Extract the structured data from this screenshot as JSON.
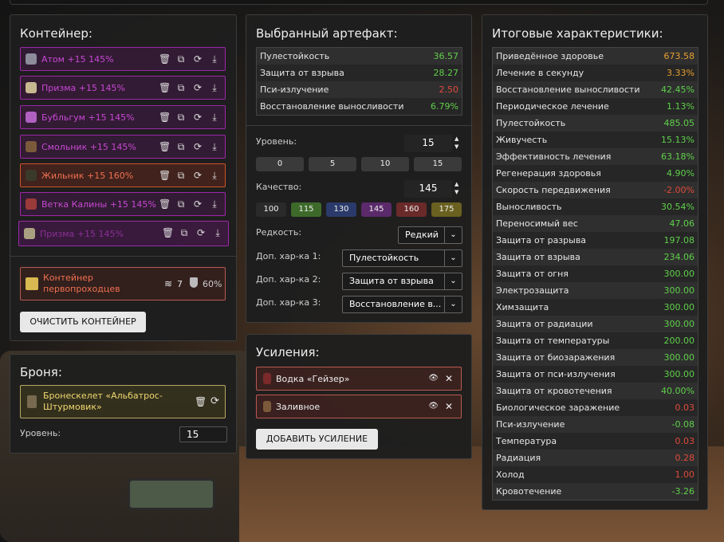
{
  "container": {
    "title": "Контейнер:",
    "items": [
      {
        "name": "Атом +15 145%",
        "color": "#8c8c9a"
      },
      {
        "name": "Призма +15 145%",
        "color": "#c8b890"
      },
      {
        "name": "Бубльгум +15 145%",
        "color": "#b060c0"
      },
      {
        "name": "Смольник +15 145%",
        "color": "#7a5a3a"
      },
      {
        "name": "Жильник +15 160%",
        "color": "#3a3a2a"
      },
      {
        "name": "Ветка Калины +15 145%",
        "color": "#9a3a3a"
      },
      {
        "name": "Призма +15 145%",
        "color": "#a8a080"
      }
    ],
    "summary_name": "Контейнер первопроходцев",
    "summary_count": "7",
    "summary_pct": "60%",
    "clear_btn": "ОЧИСТИТЬ КОНТЕЙНЕР"
  },
  "armor": {
    "title": "Броня:",
    "name": "Бронескелет «Альбатрос-Штурмовик»",
    "level_label": "Уровень:",
    "level": "15"
  },
  "artifact": {
    "title": "Выбранный артефакт:",
    "stats": [
      {
        "name": "Пулестойкость",
        "value": "36.57",
        "cls": "g"
      },
      {
        "name": "Защита от взрыва",
        "value": "28.27",
        "cls": "g"
      },
      {
        "name": "Пси-излучение",
        "value": "2.50",
        "cls": "r"
      },
      {
        "name": "Восстановление выносливости",
        "value": "6.79%",
        "cls": "g"
      }
    ],
    "level_label": "Уровень:",
    "level": "15",
    "level_presets": [
      "0",
      "5",
      "10",
      "15"
    ],
    "quality_label": "Качество:",
    "quality": "145",
    "quality_presets": [
      {
        "v": "100",
        "bg": "#2a2a2a"
      },
      {
        "v": "115",
        "bg": "#3d6a2a"
      },
      {
        "v": "130",
        "bg": "#2a3a6a"
      },
      {
        "v": "145",
        "bg": "#5a2a6a"
      },
      {
        "v": "160",
        "bg": "#6a2a2a"
      },
      {
        "v": "175",
        "bg": "#6a6020"
      }
    ],
    "rarity_label": "Редкость:",
    "rarity": "Редкий",
    "extra1_label": "Доп. хар-ка 1:",
    "extra1": "Пулестойкость",
    "extra2_label": "Доп. хар-ка 2:",
    "extra2": "Защита от взрыва",
    "extra3_label": "Доп. хар-ка 3:",
    "extra3": "Восстановление в..."
  },
  "boosts": {
    "title": "Усиления:",
    "items": [
      "Водка «Гейзер»",
      "Заливное"
    ],
    "add_btn": "ДОБАВИТЬ УСИЛЕНИЕ"
  },
  "totals": {
    "title": "Итоговые характеристики:",
    "stats": [
      {
        "name": "Приведённое здоровье",
        "value": "673.58",
        "cls": "o"
      },
      {
        "name": "Лечение в секунду",
        "value": "3.33%",
        "cls": "o"
      },
      {
        "name": "Восстановление выносливости",
        "value": "42.45%",
        "cls": "g"
      },
      {
        "name": "Периодическое лечение",
        "value": "1.13%",
        "cls": "g"
      },
      {
        "name": "Пулестойкость",
        "value": "485.05",
        "cls": "g"
      },
      {
        "name": "Живучесть",
        "value": "15.13%",
        "cls": "g"
      },
      {
        "name": "Эффективность лечения",
        "value": "63.18%",
        "cls": "g"
      },
      {
        "name": "Регенерация здоровья",
        "value": "4.90%",
        "cls": "g"
      },
      {
        "name": "Скорость передвижения",
        "value": "-2.00%",
        "cls": "r"
      },
      {
        "name": "Выносливость",
        "value": "30.54%",
        "cls": "g"
      },
      {
        "name": "Переносимый вес",
        "value": "47.06",
        "cls": "g"
      },
      {
        "name": "Защита от разрыва",
        "value": "197.08",
        "cls": "g"
      },
      {
        "name": "Защита от взрыва",
        "value": "234.06",
        "cls": "g"
      },
      {
        "name": "Защита от огня",
        "value": "300.00",
        "cls": "g"
      },
      {
        "name": "Электрозащита",
        "value": "300.00",
        "cls": "g"
      },
      {
        "name": "Химзащита",
        "value": "300.00",
        "cls": "g"
      },
      {
        "name": "Защита от радиации",
        "value": "300.00",
        "cls": "g"
      },
      {
        "name": "Защита от температуры",
        "value": "200.00",
        "cls": "g"
      },
      {
        "name": "Защита от биозаражения",
        "value": "300.00",
        "cls": "g"
      },
      {
        "name": "Защита от пси-излучения",
        "value": "300.00",
        "cls": "g"
      },
      {
        "name": "Защита от кровотечения",
        "value": "40.00%",
        "cls": "g"
      },
      {
        "name": "Биологическое заражение",
        "value": "0.03",
        "cls": "r"
      },
      {
        "name": "Пси-излучение",
        "value": "-0.08",
        "cls": "g"
      },
      {
        "name": "Температура",
        "value": "0.03",
        "cls": "r"
      },
      {
        "name": "Радиация",
        "value": "0.28",
        "cls": "r"
      },
      {
        "name": "Холод",
        "value": "1.00",
        "cls": "r"
      },
      {
        "name": "Кровотечение",
        "value": "-3.26",
        "cls": "g"
      }
    ]
  }
}
